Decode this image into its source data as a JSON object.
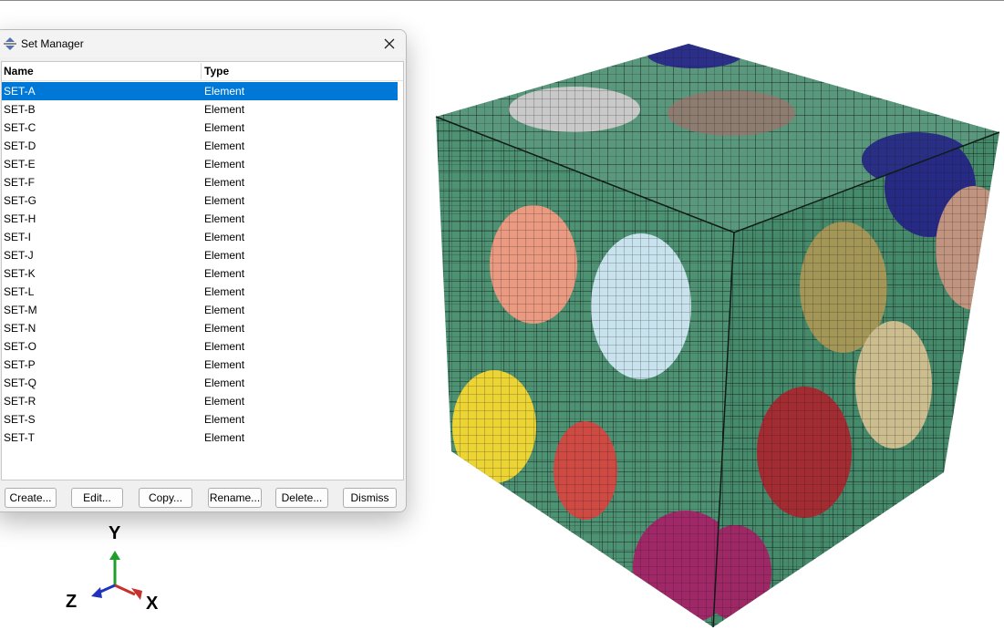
{
  "dialog": {
    "title": "Set Manager",
    "columns": {
      "name": "Name",
      "type": "Type"
    },
    "rows": [
      {
        "name": "SET-A",
        "type": "Element",
        "selected": true
      },
      {
        "name": "SET-B",
        "type": "Element"
      },
      {
        "name": "SET-C",
        "type": "Element"
      },
      {
        "name": "SET-D",
        "type": "Element"
      },
      {
        "name": "SET-E",
        "type": "Element"
      },
      {
        "name": "SET-F",
        "type": "Element"
      },
      {
        "name": "SET-G",
        "type": "Element"
      },
      {
        "name": "SET-H",
        "type": "Element"
      },
      {
        "name": "SET-I",
        "type": "Element"
      },
      {
        "name": "SET-J",
        "type": "Element"
      },
      {
        "name": "SET-K",
        "type": "Element"
      },
      {
        "name": "SET-L",
        "type": "Element"
      },
      {
        "name": "SET-M",
        "type": "Element"
      },
      {
        "name": "SET-N",
        "type": "Element"
      },
      {
        "name": "SET-O",
        "type": "Element"
      },
      {
        "name": "SET-P",
        "type": "Element"
      },
      {
        "name": "SET-Q",
        "type": "Element"
      },
      {
        "name": "SET-R",
        "type": "Element"
      },
      {
        "name": "SET-S",
        "type": "Element"
      },
      {
        "name": "SET-T",
        "type": "Element"
      }
    ],
    "buttons": {
      "create": "Create...",
      "edit": "Edit...",
      "copy": "Copy...",
      "rename": "Rename...",
      "delete": "Delete...",
      "dismiss": "Dismiss"
    }
  },
  "triad": {
    "x_label": "X",
    "y_label": "Y",
    "z_label": "Z"
  },
  "icons": {
    "title_icon": "set-manager-icon",
    "close_icon": "close-icon"
  },
  "colors": {
    "mesh_base": "#4f8f73",
    "selection": "#0078d7",
    "axis_x": "#c8312b",
    "axis_y": "#1f9e2a",
    "axis_z": "#2233bb"
  }
}
